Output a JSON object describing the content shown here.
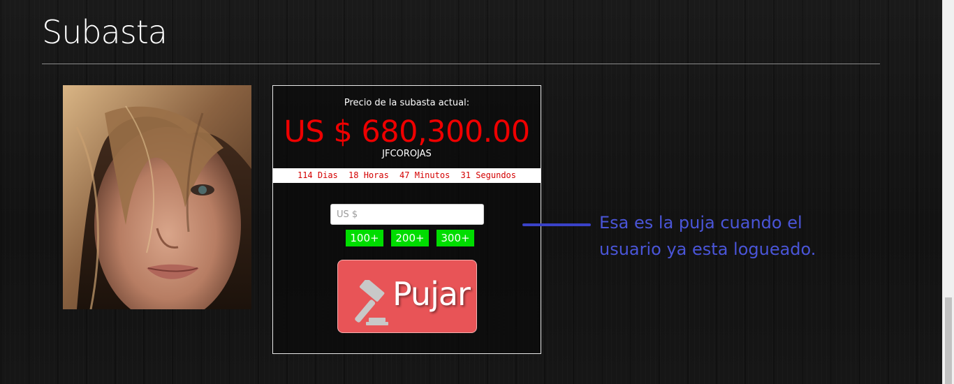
{
  "header": {
    "title": "Subasta"
  },
  "product": {
    "image": "woman-portrait-photo"
  },
  "auction": {
    "price_label": "Precio de la subasta actual:",
    "price_value": "US $ 680,300.00",
    "bidder": "JFCOROJAS",
    "countdown": {
      "days": "114 Dias",
      "hours": "18 Horas",
      "minutes": "47 Minutos",
      "seconds": "31 Segundos"
    },
    "bid_input_placeholder": "US $",
    "bid_input_value": "",
    "increments": [
      "100+",
      "200+",
      "300+"
    ],
    "bid_button_label": "Pujar",
    "bid_button_icon": "gavel-icon"
  },
  "annotation": {
    "text": "Esa es la puja cuando el usuario ya esta logueado."
  },
  "colors": {
    "price": "#ee0000",
    "countdown_text": "#d40000",
    "increment_button": "#00dd00",
    "bid_button": "#e85457",
    "annotation": "#4a55d8"
  }
}
